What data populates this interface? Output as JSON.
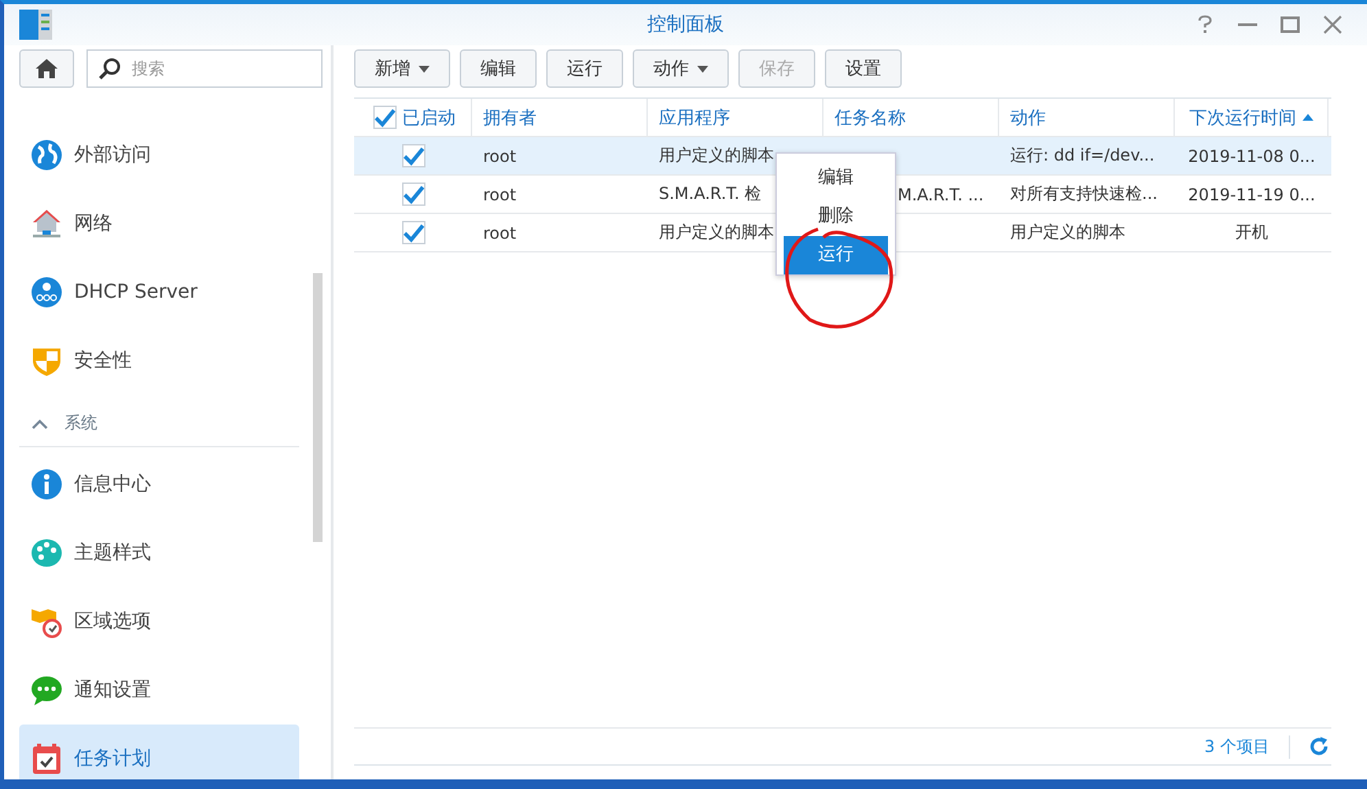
{
  "window": {
    "title": "控制面板"
  },
  "search": {
    "placeholder": "搜索"
  },
  "sidebar": [
    {
      "kind": "item",
      "label": "外部访问",
      "selected": false
    },
    {
      "kind": "item",
      "label": "网络",
      "selected": false
    },
    {
      "kind": "item",
      "label": "DHCP Server",
      "selected": false
    },
    {
      "kind": "item",
      "label": "安全性",
      "selected": false
    },
    {
      "kind": "section",
      "label": "系统",
      "expanded": true
    },
    {
      "kind": "item",
      "label": "信息中心",
      "selected": false
    },
    {
      "kind": "item",
      "label": "主题样式",
      "selected": false
    },
    {
      "kind": "item",
      "label": "区域选项",
      "selected": false
    },
    {
      "kind": "item",
      "label": "通知设置",
      "selected": false
    },
    {
      "kind": "item",
      "label": "任务计划",
      "selected": true
    }
  ],
  "toolbar": [
    {
      "label": "新增",
      "dropdown": true,
      "disabled": false
    },
    {
      "label": "编辑",
      "dropdown": false,
      "disabled": false
    },
    {
      "label": "运行",
      "dropdown": false,
      "disabled": false
    },
    {
      "label": "动作",
      "dropdown": true,
      "disabled": false
    },
    {
      "label": "保存",
      "dropdown": false,
      "disabled": true
    },
    {
      "label": "设置",
      "dropdown": false,
      "disabled": false
    }
  ],
  "table": {
    "header_checked": true,
    "columns": [
      {
        "label": "已启动",
        "sorted": false
      },
      {
        "label": "拥有者",
        "sorted": false
      },
      {
        "label": "应用程序",
        "sorted": false
      },
      {
        "label": "任务名称",
        "sorted": false
      },
      {
        "label": "动作",
        "sorted": false
      },
      {
        "label": "下次运行时间",
        "sorted": true
      }
    ],
    "rows": [
      {
        "enabled": true,
        "selected": true,
        "owner": "root",
        "app": "用户定义的脚本",
        "action": "运行: dd if=/dev...",
        "next_run": "2019-11-08 0..."
      },
      {
        "enabled": true,
        "selected": false,
        "owner": "root",
        "app": "S.M.A.R.T. 检",
        "task": "M.A.R.T. ...",
        "action": "对所有支持快速检...",
        "next_run": "2019-11-19 0..."
      },
      {
        "enabled": true,
        "selected": false,
        "owner": "root",
        "app": "用户定义的脚本",
        "action": "用户定义的脚本",
        "next_run": "开机"
      }
    ]
  },
  "context_menu": [
    {
      "label": "编辑",
      "selected": false
    },
    {
      "label": "删除",
      "selected": false
    },
    {
      "label": "运行",
      "selected": true
    }
  ],
  "status_bar": {
    "count": "3 个项目"
  }
}
